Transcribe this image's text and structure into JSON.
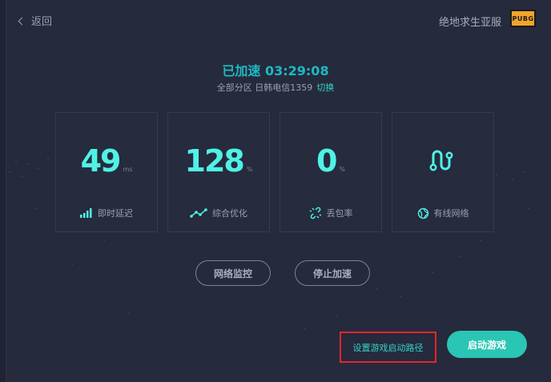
{
  "header": {
    "back_label": "返回",
    "game_name": "绝地求生亚服",
    "game_logo_text": "PUBG"
  },
  "status": {
    "text": "已加速 03:29:08",
    "server": "全部分区 日韩电信1359",
    "switch_label": "切换"
  },
  "stats": [
    {
      "value": "49",
      "unit": "ms",
      "label": "即时延迟",
      "icon": "signal-bars-icon"
    },
    {
      "value": "128",
      "unit": "%",
      "label": "综合优化",
      "icon": "trend-line-icon"
    },
    {
      "value": "0",
      "unit": "%",
      "label": "丢包率",
      "icon": "broken-link-icon"
    },
    {
      "value": "",
      "unit": "",
      "label": "有线网络",
      "icon": "globe-icon"
    }
  ],
  "buttons": {
    "monitor": "网络监控",
    "stop": "停止加速",
    "set_path": "设置游戏启动路径",
    "launch": "启动游戏"
  },
  "colors": {
    "background": "#252a3d",
    "accent": "#4ff2e6",
    "button": "#2bc5b3",
    "highlight_border": "#e8262a"
  }
}
